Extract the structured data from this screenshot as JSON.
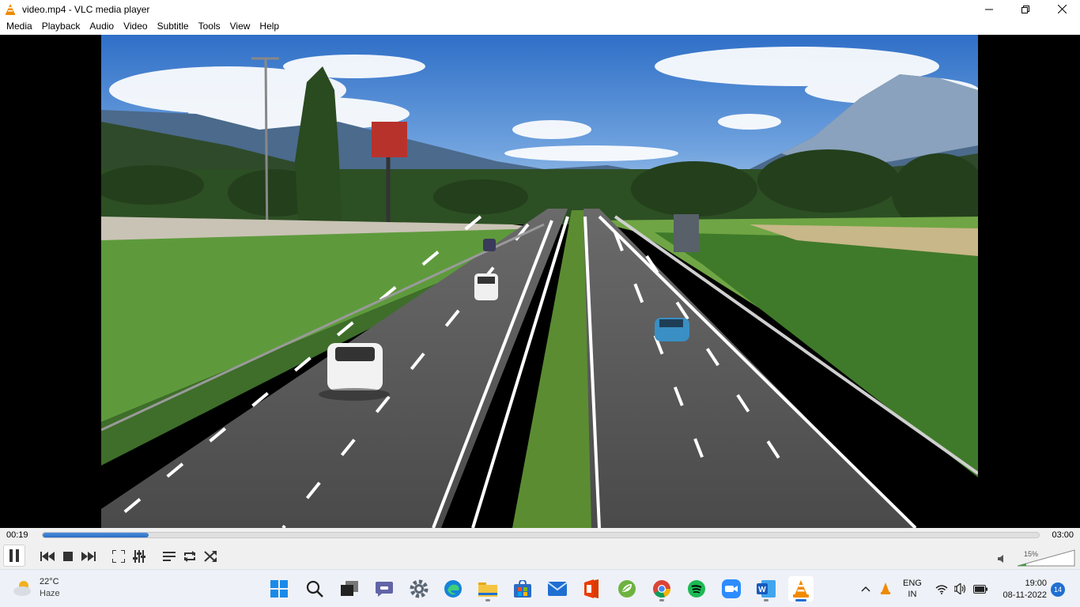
{
  "window": {
    "title": "video.mp4 - VLC media player",
    "controls": [
      "minimize-icon",
      "restore-icon",
      "close-icon"
    ]
  },
  "menu": [
    "Media",
    "Playback",
    "Audio",
    "Video",
    "Subtitle",
    "Tools",
    "View",
    "Help"
  ],
  "player": {
    "current_time": "00:19",
    "total_time": "03:00",
    "progress_fraction": 0.106,
    "volume_label": "15%",
    "volume_fraction": 0.15,
    "controls": [
      "pause-icon",
      "previous-icon",
      "stop-icon",
      "next-icon",
      "fullscreen-icon",
      "extended-settings-icon",
      "playlist-icon",
      "loop-icon",
      "shuffle-icon"
    ]
  },
  "taskbar": {
    "weather": {
      "temp": "22°C",
      "condition": "Haze"
    },
    "apps": [
      "windows-start-icon",
      "search-icon",
      "task-view-icon",
      "teams-chat-icon",
      "settings-icon",
      "edge-icon",
      "file-explorer-icon",
      "microsoft-store-icon",
      "mail-icon",
      "office-icon",
      "spring-icon",
      "chrome-icon",
      "spotify-icon",
      "zoom-icon",
      "word-icon",
      "vlc-icon"
    ],
    "language": {
      "lang": "ENG",
      "region": "IN"
    },
    "clock": {
      "time": "19:00",
      "date": "08-11-2022"
    },
    "notifications": "14"
  },
  "colors": {
    "accent": "#1f6fd1",
    "vlc_orange": "#f08a00",
    "seek_fill": "#2a6cc4"
  }
}
